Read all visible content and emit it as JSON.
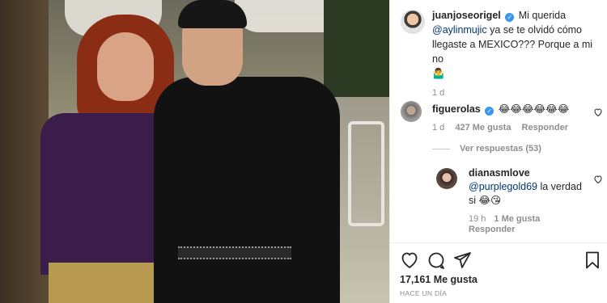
{
  "post": {
    "author": "juanjoseorigel",
    "caption_mention": "@aylinmujic",
    "caption_line1": "Mi querida",
    "caption_rest": "ya se te olvidó cómo llegaste a MEXICO??? Porque a mi no",
    "caption_emoji": "🤷‍♂️",
    "caption_age": "1 d"
  },
  "comments": [
    {
      "username": "figuerolas",
      "text": "😂😂😂😂😂😂",
      "age": "1 d",
      "likes": "427 Me gusta",
      "reply_label": "Responder",
      "view_replies": "Ver respuestas (53)"
    },
    {
      "username": "dianasmlove",
      "mention": "@purplegold69",
      "text": "la verdad si 😂😘",
      "age": "19 h",
      "likes": "1 Me gusta",
      "reply_label": "Responder"
    }
  ],
  "footer": {
    "likes": "17,161 Me gusta",
    "time_ago": "HACE UN DÍA"
  },
  "icons": {
    "like": "heart-icon",
    "comment": "comment-icon",
    "share": "paper-plane-icon",
    "save": "bookmark-icon",
    "verified": "verified-badge-icon"
  },
  "colors": {
    "verified": "#3897f0",
    "mention": "#00376b",
    "muted": "#8e8e8e",
    "text": "#262626"
  }
}
